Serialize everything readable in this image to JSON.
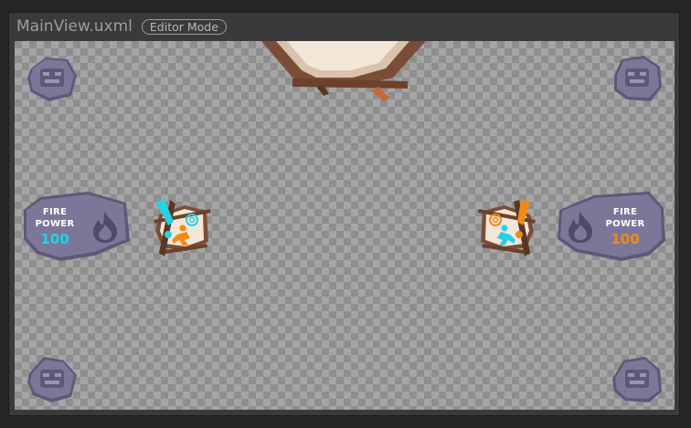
{
  "window": {
    "title": "MainView.uxml",
    "badge": "Editor Mode"
  },
  "icons": {
    "corner_button": "stone-face-icon",
    "panel_icon": "flame-icon",
    "card_left_glyphs": [
      "exclamation-icon",
      "swirl-icon",
      "running-figure-icon"
    ],
    "card_right_glyphs": [
      "swirl-icon",
      "exclamation-icon",
      "running-figure-icon"
    ]
  },
  "panels": {
    "left": {
      "line1": "FIRE",
      "line2": "POWER",
      "value": "100"
    },
    "right": {
      "line1": "FIRE",
      "line2": "POWER",
      "value": "100"
    }
  },
  "colors": {
    "canvas_checker_dark": "#8e8e8e",
    "canvas_checker_light": "#a5a5a5",
    "stone": "#7c7799",
    "stone_dark": "#5e5878",
    "wood": "#7a4e36",
    "parchment": "#f3e6d8",
    "cyan": "#23d3e3",
    "orange": "#f08a17"
  }
}
